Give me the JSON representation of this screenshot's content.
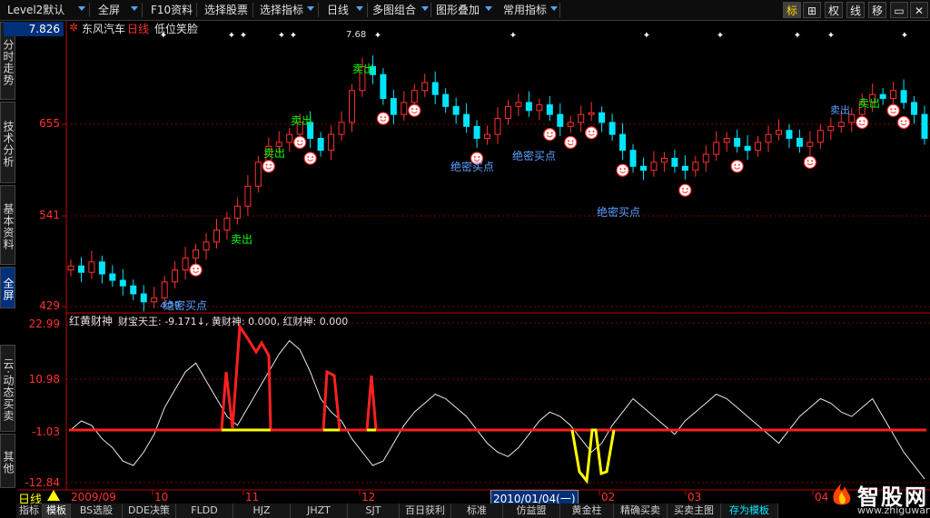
{
  "toolbar": {
    "items": [
      "Level2默认",
      "全屏",
      "F10资料",
      "选择股票",
      "选择指标",
      "日线",
      "多图组合",
      "图形叠加",
      "常用指标"
    ],
    "right_buttons": [
      "标",
      "⊞",
      "权",
      "线",
      "移",
      "▭",
      "✕"
    ]
  },
  "left_tabs": [
    "分时走势",
    "技术分析",
    "基本资料",
    "全屏",
    "云·动态买卖",
    "其他"
  ],
  "main_chart": {
    "stock_name": "东风汽车",
    "period": "日线",
    "indicator_name": "低位笑脸",
    "top_left_price": "7.826",
    "y_ticks": [
      "655",
      "541",
      "429"
    ],
    "high_label": "7.68",
    "low_label": "4.29",
    "annotations": [
      "卖出",
      "卖出",
      "卖出",
      "卖出",
      "卖出",
      "卖出",
      "绝密买点",
      "绝密买点",
      "绝密买点",
      "绝密买点"
    ]
  },
  "sub_chart": {
    "title": "红黄财神",
    "value_line": "财宝天王: -9.171↓, 黄财神: 0.000, 红财神: 0.000",
    "y_ticks": [
      "22.99",
      "10.98",
      "-1.03",
      "-12.84"
    ]
  },
  "date_axis": {
    "period_label": "日线",
    "labels": [
      "2009/09",
      "10",
      "11",
      "12",
      "2010/01/04(一)",
      "02",
      "03",
      "04"
    ]
  },
  "bottom_tabs": [
    "指标",
    "模板",
    "BS选股",
    "DDE决策",
    "FLDD",
    "HJZ",
    "JHZT",
    "SJT",
    "百日获利",
    "标准",
    "仿益盟",
    "黄金柱",
    "精确买卖",
    "买卖主图",
    "存为模板"
  ],
  "watermark": {
    "name": "智股网",
    "url": "www.zhiguwang.com"
  },
  "colors": {
    "up": "#ff3030",
    "down": "#00e5ff",
    "accent": "#ffff00",
    "toolbar_arrow": "#5aa0ff"
  },
  "chart_data": {
    "type": "candlestick",
    "x_range": [
      "2009/09",
      "2010/04"
    ],
    "ylim": [
      4.29,
      7.68
    ],
    "series": [
      {
        "name": "收盘",
        "values": [
          4.8,
          4.72,
          4.85,
          4.7,
          4.62,
          4.55,
          4.45,
          4.35,
          4.4,
          4.6,
          4.75,
          4.9,
          5.0,
          5.1,
          5.25,
          5.4,
          5.55,
          5.8,
          6.1,
          6.3,
          6.35,
          6.45,
          6.6,
          6.4,
          6.25,
          6.45,
          6.6,
          7.0,
          7.3,
          7.2,
          6.9,
          6.7,
          6.85,
          7.0,
          7.1,
          6.95,
          6.8,
          6.7,
          6.55,
          6.4,
          6.45,
          6.65,
          6.8,
          6.85,
          6.75,
          6.82,
          6.7,
          6.55,
          6.6,
          6.7,
          6.72,
          6.6,
          6.45,
          6.25,
          6.05,
          6.0,
          6.1,
          6.15,
          6.05,
          6.0,
          6.1,
          6.2,
          6.35,
          6.4,
          6.3,
          6.25,
          6.35,
          6.45,
          6.5,
          6.4,
          6.3,
          6.35,
          6.5,
          6.55,
          6.6,
          6.7,
          6.85,
          6.95,
          6.9,
          7.0,
          6.85,
          6.7,
          6.4
        ]
      }
    ],
    "sub_series": [
      {
        "name": "财宝天王",
        "last": -9.171
      },
      {
        "name": "黄财神",
        "last": 0.0
      },
      {
        "name": "红财神",
        "last": 0.0
      }
    ],
    "sub_ylim": [
      -12.84,
      22.99
    ]
  }
}
